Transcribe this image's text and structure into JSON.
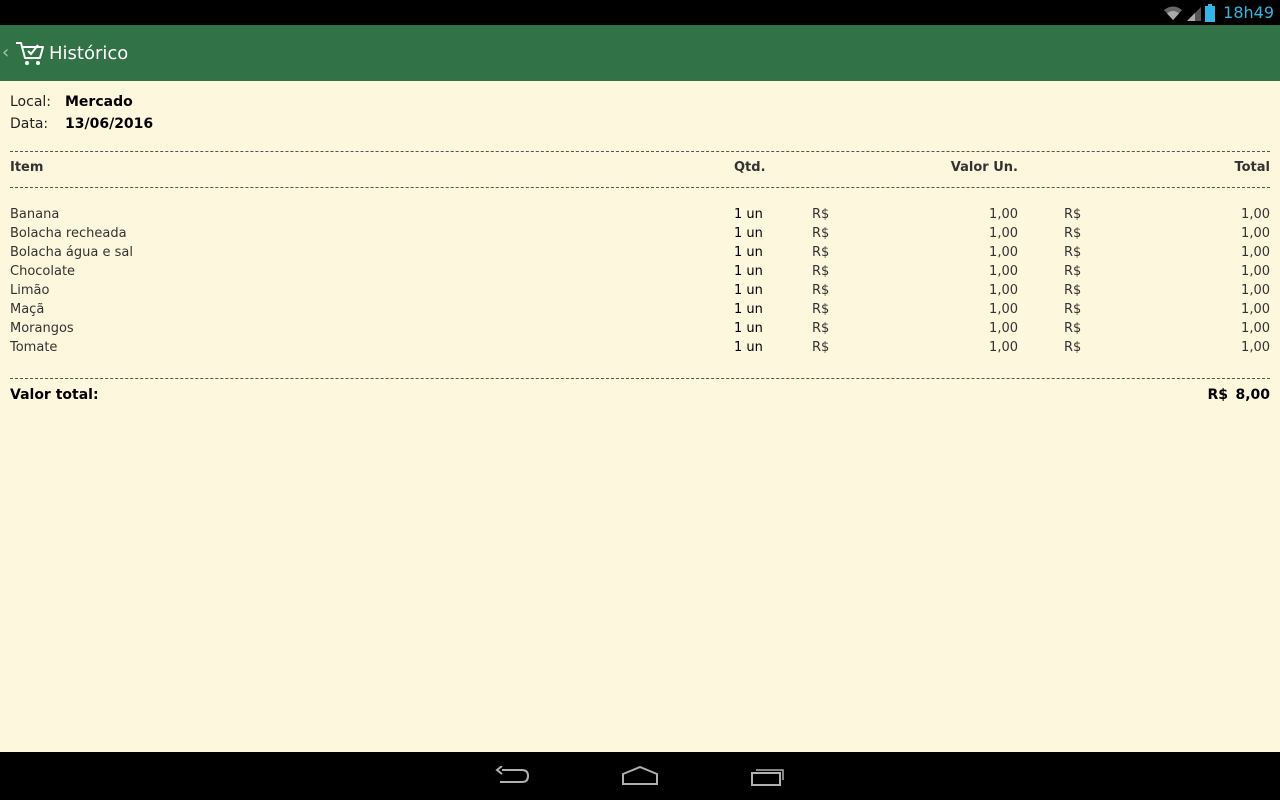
{
  "status_bar": {
    "time": "18h49",
    "icons": [
      "wifi-icon",
      "cell-signal-icon",
      "battery-icon"
    ],
    "accent_color": "#33b5e5"
  },
  "action_bar": {
    "title": "Histórico",
    "background_color": "#317246",
    "up_icon": "chevron-left-icon",
    "app_icon": "shopping-cart-icon"
  },
  "receipt": {
    "local_label": "Local:",
    "local_value": "Mercado",
    "date_label": "Data:",
    "date_value": "13/06/2016",
    "columns": {
      "item": "Item",
      "qty": "Qtd.",
      "unit_value": "Valor Un.",
      "total": "Total"
    },
    "items": [
      {
        "name": "Banana",
        "qty": "1 un",
        "cur_unit": "R$",
        "unit": "1,00",
        "cur_total": "R$",
        "total": "1,00"
      },
      {
        "name": "Bolacha recheada",
        "qty": "1 un",
        "cur_unit": "R$",
        "unit": "1,00",
        "cur_total": "R$",
        "total": "1,00"
      },
      {
        "name": "Bolacha água e sal",
        "qty": "1 un",
        "cur_unit": "R$",
        "unit": "1,00",
        "cur_total": "R$",
        "total": "1,00"
      },
      {
        "name": "Chocolate",
        "qty": "1 un",
        "cur_unit": "R$",
        "unit": "1,00",
        "cur_total": "R$",
        "total": "1,00"
      },
      {
        "name": "Limão",
        "qty": "1 un",
        "cur_unit": "R$",
        "unit": "1,00",
        "cur_total": "R$",
        "total": "1,00"
      },
      {
        "name": "Maçã",
        "qty": "1 un",
        "cur_unit": "R$",
        "unit": "1,00",
        "cur_total": "R$",
        "total": "1,00"
      },
      {
        "name": "Morangos",
        "qty": "1 un",
        "cur_unit": "R$",
        "unit": "1,00",
        "cur_total": "R$",
        "total": "1,00"
      },
      {
        "name": "Tomate",
        "qty": "1 un",
        "cur_unit": "R$",
        "unit": "1,00",
        "cur_total": "R$",
        "total": "1,00"
      }
    ],
    "total_label": "Valor total:",
    "total_currency": "R$",
    "total_value": "8,00",
    "background_color": "#fdf7dd"
  },
  "nav_bar": {
    "buttons": [
      "back-icon",
      "home-icon",
      "recent-apps-icon"
    ]
  }
}
